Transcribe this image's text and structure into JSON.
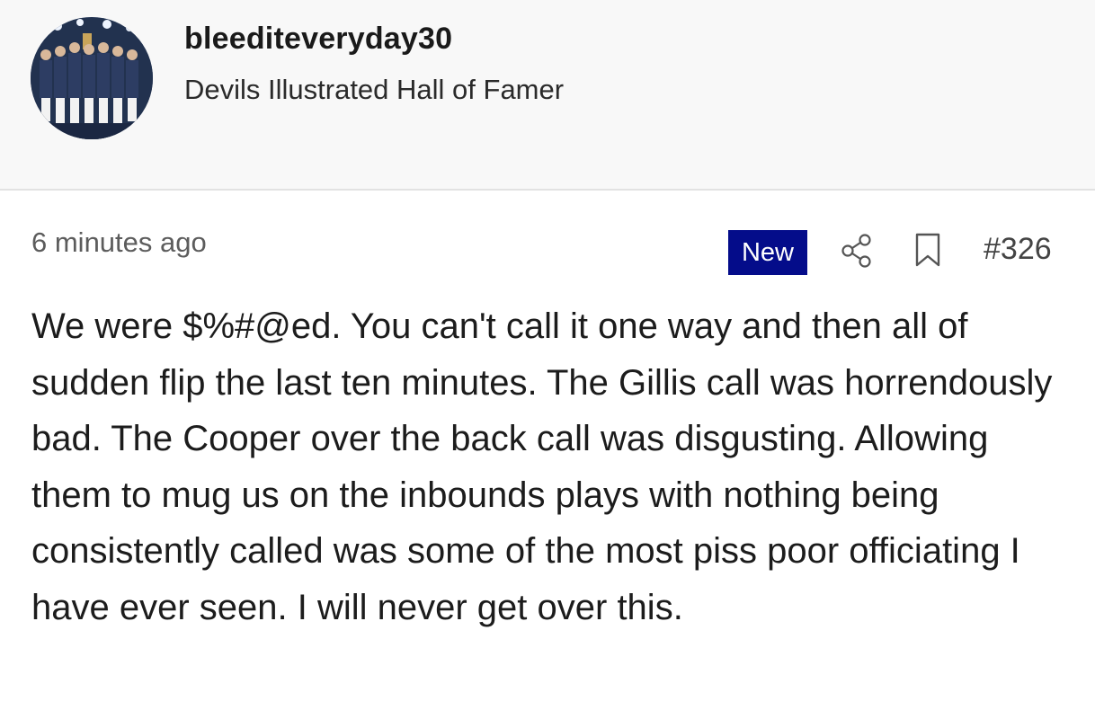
{
  "user": {
    "username": "bleediteveryday30",
    "title": "Devils Illustrated Hall of Famer",
    "avatar_icon": "team-photo-avatar"
  },
  "post": {
    "timestamp": "6 minutes ago",
    "badge": "New",
    "badge_color": "#040c8a",
    "share_icon": "share-icon",
    "bookmark_icon": "bookmark-icon",
    "number": "#326",
    "body": "We were $%#@ed. You can't call it one way and then all of sudden flip the last ten minutes. The Gillis call was horrendously bad. The Cooper over the back call was disgusting. Allowing them to mug us on the inbounds plays with nothing being consistently called was some of the most piss poor officiating I have ever seen. I will never get over this."
  }
}
